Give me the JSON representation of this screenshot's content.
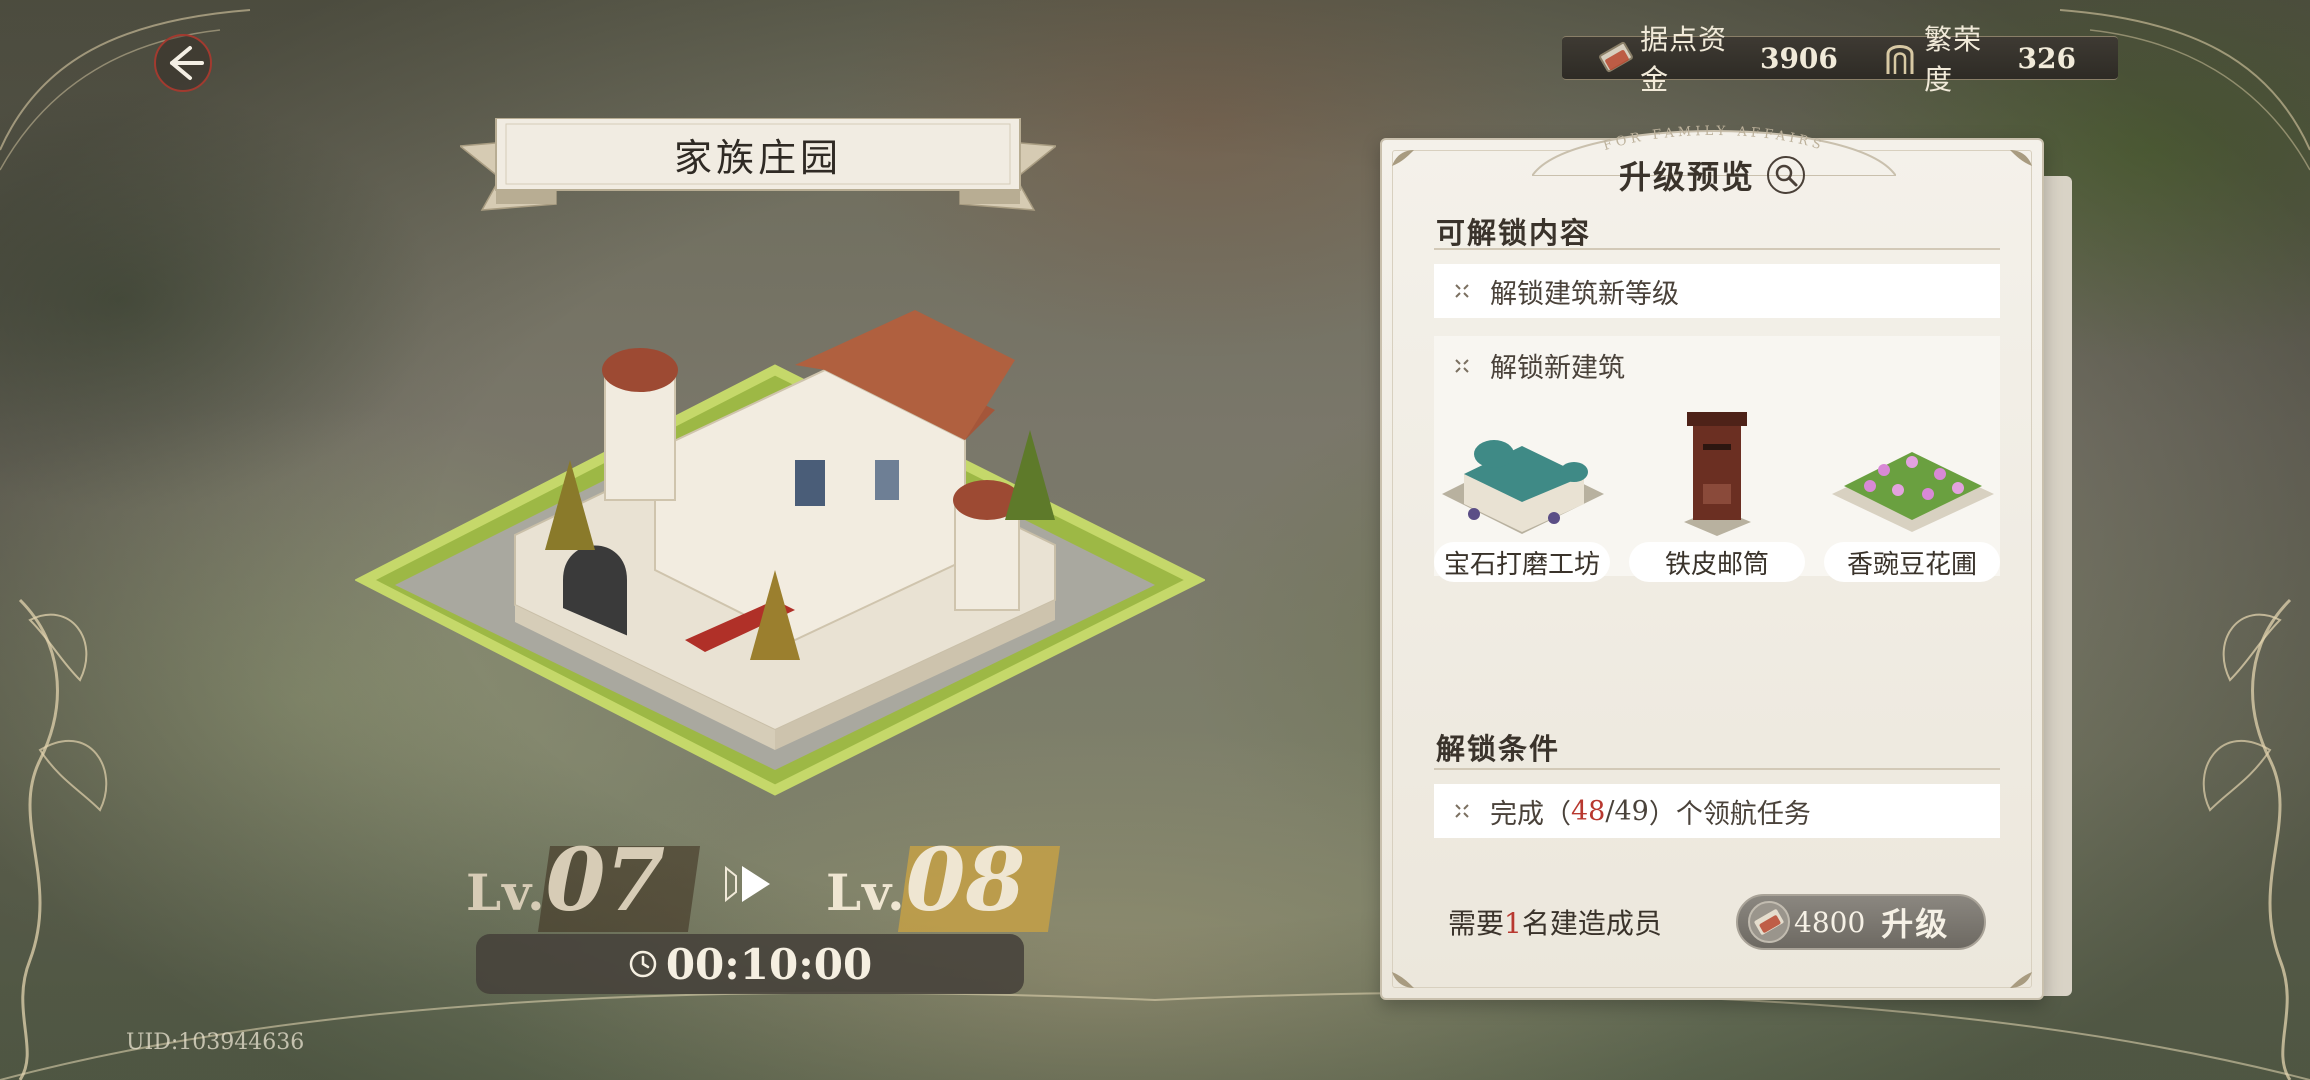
{
  "header": {
    "back_icon": "back-arrow-icon",
    "resources": [
      {
        "icon": "ticket-funds-icon",
        "label": "据点资金",
        "value": "3906"
      },
      {
        "icon": "prosperity-arch-icon",
        "label": "繁荣度",
        "value": "326"
      }
    ]
  },
  "building": {
    "title": "家族庄园",
    "illustration_icon": "manor-building-icon"
  },
  "levels": {
    "current_prefix": "Lv.",
    "current_value": "07",
    "next_prefix": "Lv.",
    "next_value": "08",
    "arrow_icon": "play-arrow-icon"
  },
  "timer": {
    "icon": "clock-icon",
    "value": "00:10:00"
  },
  "uid": "UID:103944636",
  "panel": {
    "arch_text": "FOR FAMILY AFFAIRS",
    "title": "升级预览",
    "preview_icon": "magnifier-icon",
    "unlock_section": "可解锁内容",
    "unlock_items": [
      {
        "label": "解锁建筑新等级"
      },
      {
        "label": "解锁新建筑"
      }
    ],
    "new_buildings": [
      {
        "label": "宝石打磨工坊",
        "icon": "gem-workshop-icon"
      },
      {
        "label": "铁皮邮筒",
        "icon": "iron-mailbox-icon"
      },
      {
        "label": "香豌豆花圃",
        "icon": "sweetpea-flowerbed-icon"
      }
    ],
    "condition_section": "解锁条件",
    "condition": {
      "prefix": "完成（",
      "current": "48",
      "separator": "/",
      "total": "49",
      "suffix": "）个领航任务"
    },
    "builder": {
      "prefix": "需要",
      "count": "1",
      "suffix": "名建造成员"
    },
    "upgrade_button": {
      "icon": "ticket-funds-icon",
      "cost": "4800",
      "label": "升级"
    }
  },
  "colors": {
    "panel_bg": "#f4f1ea",
    "accent_red": "#b8382f",
    "gold": "#c4a046",
    "dark_bar": "#2e2b25"
  }
}
